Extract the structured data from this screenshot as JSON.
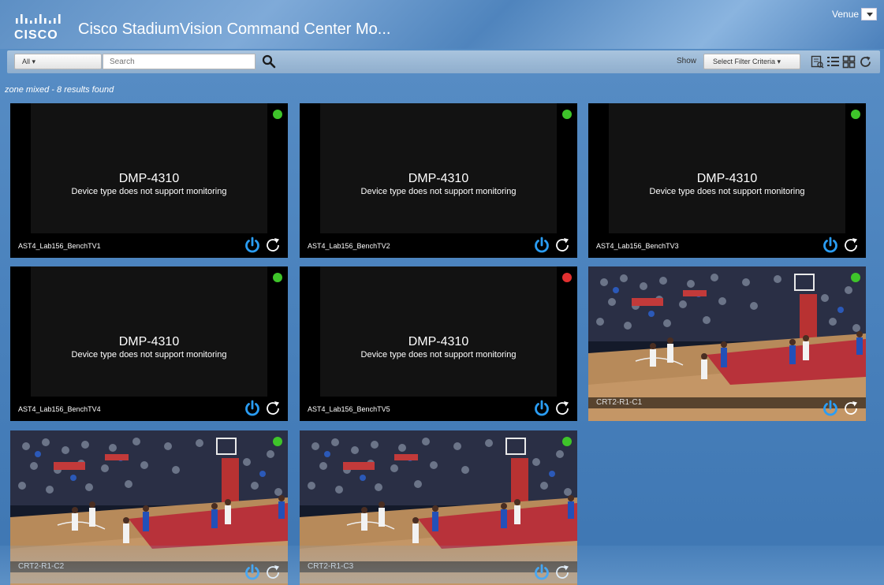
{
  "header": {
    "logo_text": "CISCO",
    "title": "Cisco StadiumVision Command Center Mo...",
    "venue_label": "Venue"
  },
  "toolbar": {
    "all_label": "All ▾",
    "search_placeholder": "Search",
    "show_label": "Show",
    "filter_label": "Select Filter Criteria ▾"
  },
  "results_text": "zone mixed - 8 results found",
  "devices": [
    {
      "name": "AST4_Lab156_BenchTV1",
      "model": "DMP-4310",
      "message": "Device type does not support monitoring",
      "status": "online",
      "status_color": "#3ec42a"
    },
    {
      "name": "AST4_Lab156_BenchTV2",
      "model": "DMP-4310",
      "message": "Device type does not support monitoring",
      "status": "online",
      "status_color": "#3ec42a"
    },
    {
      "name": "AST4_Lab156_BenchTV3",
      "model": "DMP-4310",
      "message": "Device type does not support monitoring",
      "status": "online",
      "status_color": "#3ec42a"
    },
    {
      "name": "AST4_Lab156_BenchTV4",
      "model": "DMP-4310",
      "message": "Device type does not support monitoring",
      "status": "online",
      "status_color": "#3ec42a"
    },
    {
      "name": "AST4_Lab156_BenchTV5",
      "model": "DMP-4310",
      "message": "Device type does not support monitoring",
      "status": "offline",
      "status_color": "#e23030"
    },
    {
      "name": "CRT2-R1-C1",
      "preview": "basketball-game",
      "status": "online",
      "status_color": "#3ec42a"
    },
    {
      "name": "CRT2-R1-C2",
      "preview": "basketball-game",
      "status": "online",
      "status_color": "#3ec42a"
    },
    {
      "name": "CRT2-R1-C3",
      "preview": "basketball-game",
      "status": "online",
      "status_color": "#3ec42a"
    }
  ],
  "colors": {
    "background": "#4a82bd",
    "power_icon": "#2a9df4",
    "status_online": "#3ec42a",
    "status_offline": "#e23030"
  },
  "icons": [
    "search-icon",
    "power-icon",
    "refresh-icon",
    "list-view-icon",
    "grid-view-icon",
    "detail-view-icon"
  ]
}
